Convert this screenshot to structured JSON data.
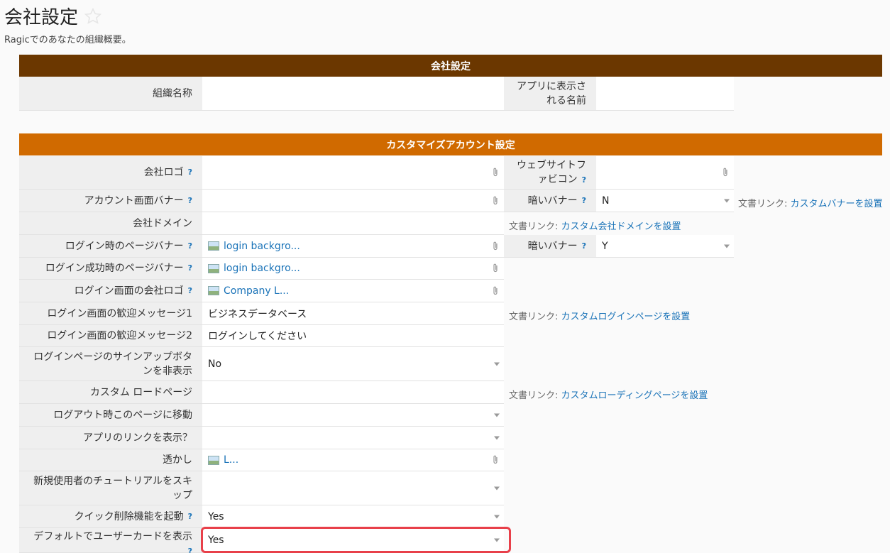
{
  "page": {
    "title": "会社設定",
    "subtitle": "Ragicでのあなたの組織概要。"
  },
  "section1": {
    "header": "会社設定",
    "org_name_label": "組織名称",
    "org_name_value": "",
    "app_name_label_line1": "アプリに表示さ",
    "app_name_label_line2": "れる名前",
    "app_name_value": ""
  },
  "section2": {
    "header": "カスタマイズアカウント設定",
    "help": "?",
    "rows": {
      "company_logo": {
        "label": "会社ロゴ",
        "value": ""
      },
      "account_banner": {
        "label": "アカウント画面バナー",
        "value": ""
      },
      "company_domain": {
        "label": "会社ドメイン",
        "value": ""
      },
      "login_page_banner": {
        "label": "ログイン時のページバナー",
        "value": "login backgro..."
      },
      "login_success_banner": {
        "label": "ログイン成功時のページバナー",
        "value": "login backgro..."
      },
      "login_company_logo": {
        "label": "ログイン画面の会社ロゴ",
        "value": "Company L..."
      },
      "welcome1": {
        "label": "ログイン画面の歓迎メッセージ1",
        "value": "ビジネスデータベース"
      },
      "welcome2": {
        "label": "ログイン画面の歓迎メッセージ2",
        "value": "ログインしてください"
      },
      "hide_signup": {
        "label_line1": "ログインページのサインアップボタ",
        "label_line2": "ンを非表示",
        "value": "No"
      },
      "custom_loading": {
        "label": "カスタム ロードページ",
        "value": ""
      },
      "logout_redirect": {
        "label": "ログアウト時このページに移動",
        "value": ""
      },
      "show_app_link": {
        "label": "アプリのリンクを表示？",
        "value": ""
      },
      "watermark": {
        "label": "透かし",
        "value": "L..."
      },
      "skip_tutorial": {
        "label_line1": "新規使用者のチュートリアルをスキ",
        "label_line2": "ップ",
        "value": ""
      },
      "quick_delete": {
        "label": "クイック削除機能を起動",
        "value": "Yes"
      },
      "default_user_card": {
        "label": "デフォルトでユーザーカードを表示",
        "value": "Yes"
      }
    },
    "right": {
      "favicon_label_line1": "ウェブサイトフ",
      "favicon_label_line2": "ァビコン",
      "favicon_value": "",
      "dark_banner_label": "暗いバナー",
      "dark_banner_value_1": "N",
      "dark_banner_value_2": "Y"
    },
    "doc_links": {
      "prefix": "文書リンク: ",
      "custom_banner": "カスタムバナーを設置",
      "custom_domain": "カスタム会社ドメインを設置",
      "custom_login": "カスタムログインページを設置",
      "custom_loading": "カスタムローディングページを設置"
    }
  }
}
